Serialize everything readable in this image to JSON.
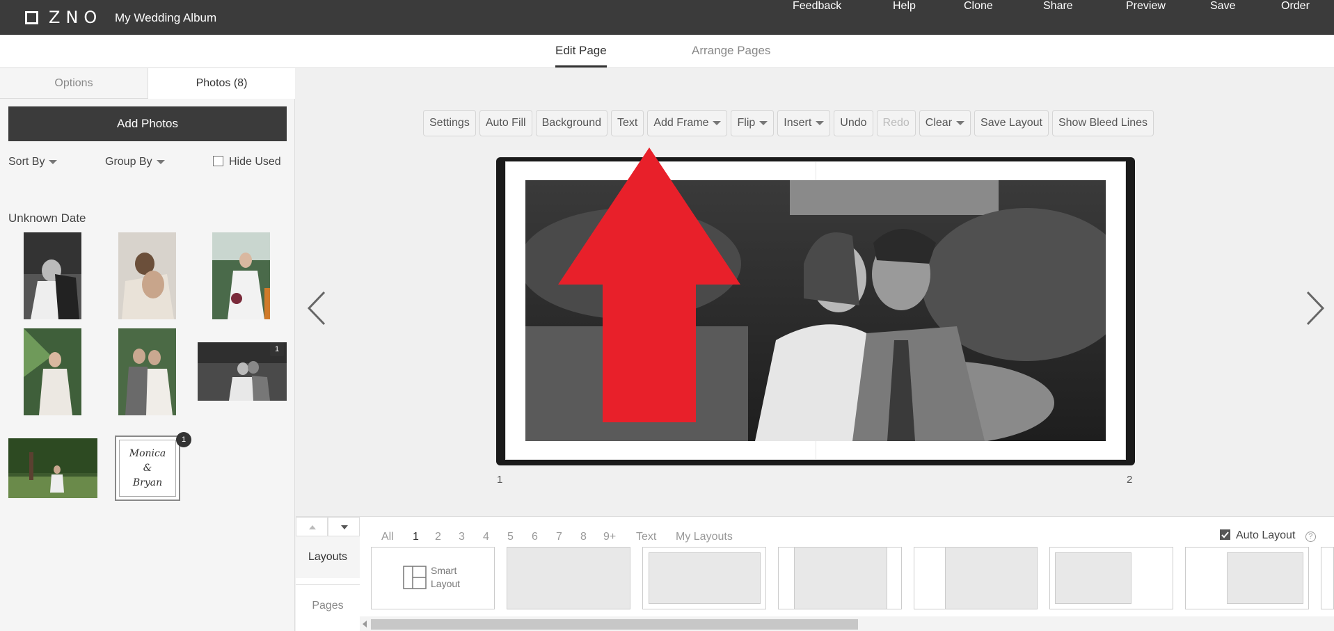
{
  "topbar": {
    "brand": "ZNO",
    "album_title": "My Wedding Album",
    "nav": [
      "Feedback",
      "Help",
      "Clone",
      "Share",
      "Preview",
      "Save",
      "Order"
    ]
  },
  "subtabs": [
    "Edit Page",
    "Arrange Pages"
  ],
  "left": {
    "tabs": [
      "Options",
      "Photos (8)"
    ],
    "add_photos": "Add Photos",
    "sort_by": "Sort By",
    "group_by": "Group By",
    "hide_used": "Hide Used",
    "date_label": "Unknown Date",
    "badge_1": "1",
    "badge_2": "1",
    "monogram": [
      "Monica",
      "&",
      "Bryan"
    ]
  },
  "toolbar": [
    "Settings",
    "Auto Fill",
    "Background",
    "Text",
    "Add Frame",
    "Flip",
    "Insert",
    "Undo",
    "Redo",
    "Clear",
    "Save Layout",
    "Show Bleed Lines"
  ],
  "pages": {
    "left_num": "1",
    "right_num": "2"
  },
  "bottom": {
    "side_tabs": [
      "Layouts",
      "Pages"
    ],
    "filters": [
      "All",
      "1",
      "2",
      "3",
      "4",
      "5",
      "6",
      "7",
      "8",
      "9+",
      "Text",
      "My Layouts"
    ],
    "auto_layout": "Auto Layout",
    "smart_layout": [
      "Smart",
      "Layout"
    ],
    "help_icon": "?"
  },
  "colors": {
    "topbar": "#3b3b3b",
    "arrow": "#e8202a"
  }
}
